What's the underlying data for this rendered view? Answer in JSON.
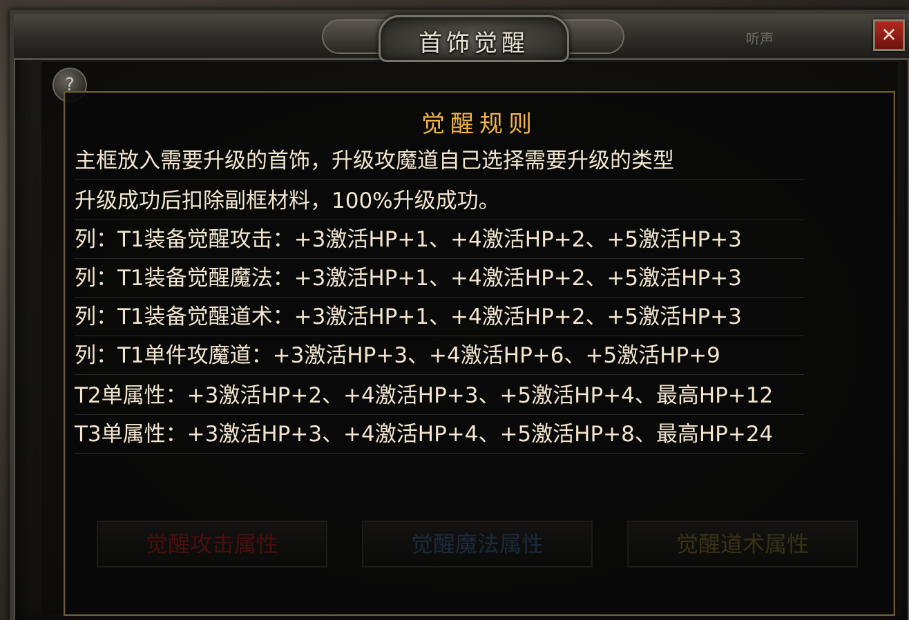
{
  "window": {
    "title": "首饰觉醒",
    "close_label": "✕",
    "help_label": "?",
    "listen_text": "听声"
  },
  "rules": {
    "title": "觉醒规则",
    "lines": [
      "主框放入需要升级的首饰，升级攻魔道自己选择需要升级的类型",
      "升级成功后扣除副框材料，100%升级成功。",
      "列：T1装备觉醒攻击：+3激活HP+1、+4激活HP+2、+5激活HP+3",
      "列：T1装备觉醒魔法：+3激活HP+1、+4激活HP+2、+5激活HP+3",
      "列：T1装备觉醒道术：+3激活HP+1、+4激活HP+2、+5激活HP+3",
      "列：T1单件攻魔道：+3激活HP+3、+4激活HP+6、+5激活HP+9",
      "T2单属性：+3激活HP+2、+4激活HP+3、+5激活HP+4、最高HP+12",
      "T3单属性：+3激活HP+3、+4激活HP+4、+5激活HP+8、最高HP+24"
    ]
  },
  "buttons": {
    "attack": "觉醒攻击属性",
    "magic": "觉醒魔法属性",
    "tao": "觉醒道术属性"
  },
  "colors": {
    "title": "#f0b44a",
    "rule_text": "#f2e6cf",
    "close": "#b32a1e"
  }
}
